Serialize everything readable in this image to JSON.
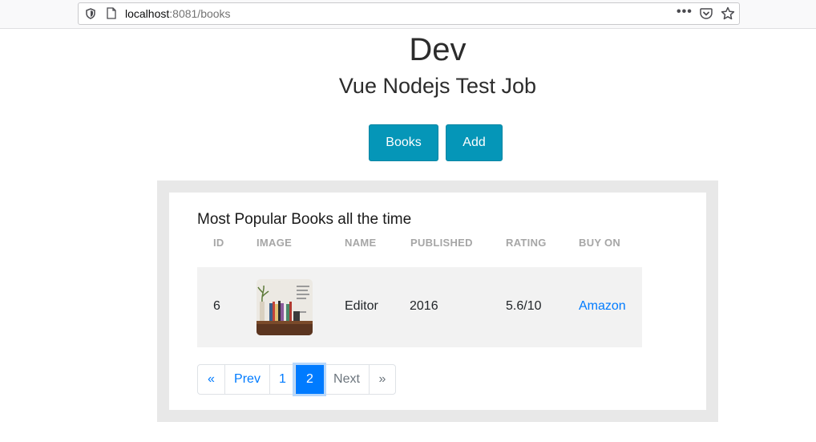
{
  "browser": {
    "url_host": "localhost",
    "url_rest": ":8081/books",
    "shield_icon": "shield-icon",
    "page_icon": "page-icon",
    "menu": "•••",
    "pocket_icon": "pocket-icon",
    "star_icon": "star-icon"
  },
  "header": {
    "title": "Dev",
    "subtitle": "Vue Nodejs Test Job"
  },
  "nav": {
    "books_label": "Books",
    "add_label": "Add"
  },
  "table": {
    "title": "Most Popular Books all the time",
    "columns": [
      "ID",
      "IMAGE",
      "NAME",
      "PUBLISHED",
      "RATING",
      "BUY ON"
    ],
    "rows": [
      {
        "id": "6",
        "image": "book-cover-image",
        "name": "Editor",
        "published": "2016",
        "rating": "5.6/10",
        "buy_on": "Amazon"
      }
    ]
  },
  "pagination": {
    "first": "«",
    "prev": "Prev",
    "pages": [
      "1",
      "2"
    ],
    "active_page": "2",
    "next": "Next",
    "last": "»"
  },
  "colors": {
    "button": "#0596b8",
    "link": "#007bff",
    "panel_bg": "#e8e8e8",
    "row_bg": "#f2f2f2"
  }
}
